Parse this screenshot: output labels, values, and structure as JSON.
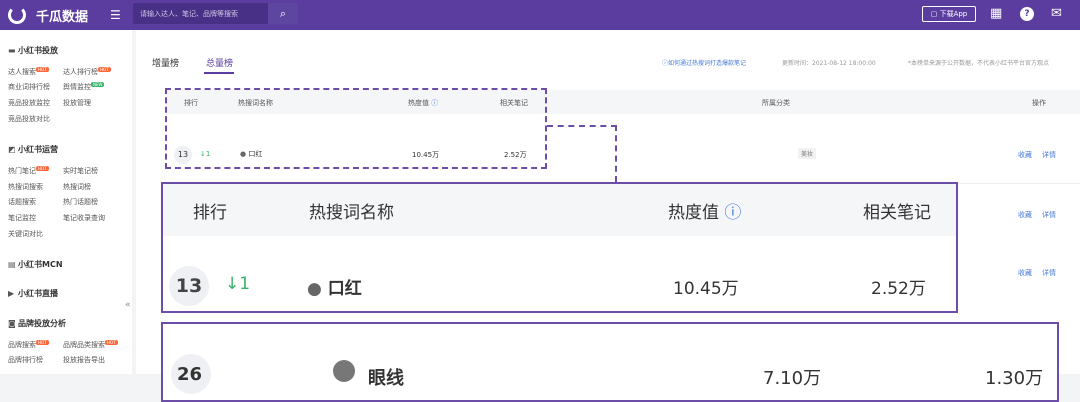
{
  "topbar": {
    "brand": "千瓜数据",
    "search_placeholder": "请输入达人、笔记、品牌等搜索",
    "download_label": "下载App",
    "icons": [
      "logo-icon",
      "menu-icon",
      "search-icon",
      "apps-icon",
      "help-icon",
      "mail-icon"
    ]
  },
  "sidebar": {
    "sections": [
      {
        "title": "小红书投放",
        "links": [
          "达人搜索",
          "达人排行榜",
          "商业词排行榜",
          "舆情监控",
          "竞品投放监控",
          "投放管理",
          "竞品投放对比"
        ]
      },
      {
        "title": "小红书运营",
        "links": [
          "热门笔记",
          "实时笔记榜",
          "热搜词搜索",
          "热搜词榜",
          "话题搜索",
          "热门话题榜",
          "笔记监控",
          "笔记收录查询",
          "关键词对比"
        ]
      },
      {
        "title": "小红书MCN",
        "links": []
      },
      {
        "title": "小红书直播",
        "links": []
      },
      {
        "title": "品牌投放分析",
        "links": [
          "品牌搜索",
          "品牌品类搜索",
          "品牌排行榜",
          "投放报告导出"
        ]
      }
    ],
    "badge_hot": "HOT",
    "badge_new": "NEW",
    "collapse": "«"
  },
  "tabs": [
    "增量榜",
    "总量榜"
  ],
  "active_tab": "总量榜",
  "header_info": {
    "help_link": "如何通过热搜词打造爆款笔记",
    "updated": "更新时间：2021-08-12 18:00:00",
    "note": "*本榜单来源于公开数据，不代表小红书平台官方观点"
  },
  "table": {
    "columns": [
      "排行",
      "热搜词名称",
      "热度值",
      "相关笔记",
      "所属分类",
      "操作"
    ],
    "row": {
      "rank": "13",
      "change": "↓1",
      "keyword": "口红",
      "heat": "10.45万",
      "notes": "2.52万",
      "category": "美妆"
    },
    "actions": [
      "收藏",
      "详情"
    ]
  },
  "zoom": {
    "columns": [
      "排行",
      "热搜词名称",
      "热度值",
      "相关笔记"
    ],
    "row": {
      "rank": "13",
      "change": "↓1",
      "keyword": "口红",
      "heat": "10.45万",
      "notes": "2.52万"
    }
  },
  "zoom2": {
    "rank": "26",
    "keyword": "眼线",
    "heat": "7.10万",
    "notes": "1.30万"
  },
  "colors": {
    "brand": "#5a3d9e",
    "link": "#4a7bd8",
    "down": "#3bb36a"
  }
}
